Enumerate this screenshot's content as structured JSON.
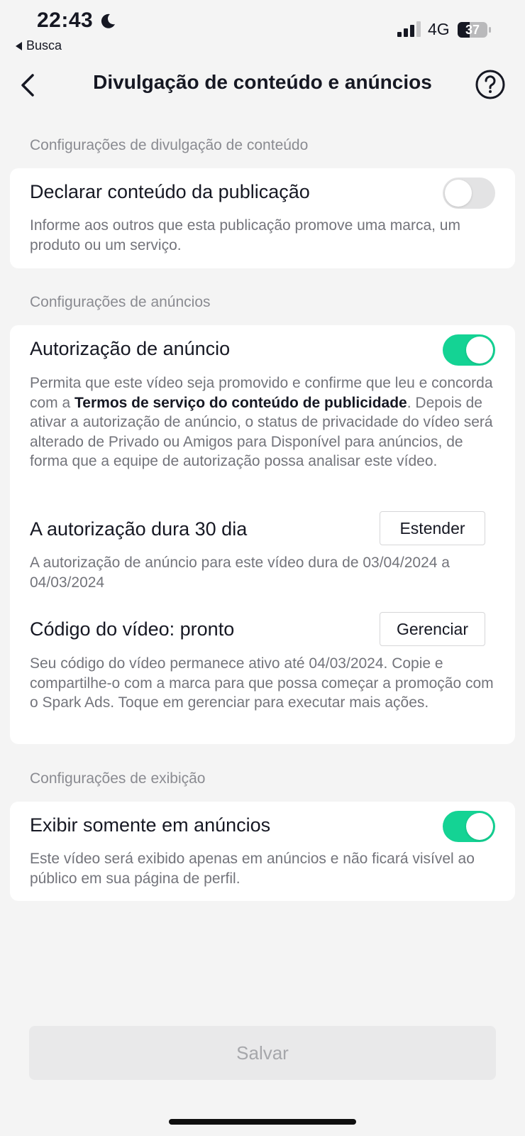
{
  "status_bar": {
    "time": "22:43",
    "back_app": "Busca",
    "network": "4G",
    "battery": "37"
  },
  "header": {
    "title": "Divulgação de conteúdo e anúncios"
  },
  "sections": {
    "content_disclosure": {
      "label": "Configurações de divulgação de conteúdo",
      "declare_title": "Declarar conteúdo da publicação",
      "declare_desc": "Informe aos outros que esta publicação promove uma marca, um produto ou um serviço.",
      "declare_enabled": false
    },
    "ads": {
      "label": "Configurações de anúncios",
      "auth_title": "Autorização de anúncio",
      "auth_desc_pre": "Permita que este vídeo seja promovido e confirme que leu e concorda com a ",
      "auth_desc_link": "Termos de serviço do conteúdo de publicidade",
      "auth_desc_post": ". Depois de ativar a autorização de anúncio, o status de privacidade do vídeo será alterado de Privado ou Amigos para Disponível para anúncios, de forma que a equipe de autorização possa analisar este vídeo.",
      "auth_enabled": true,
      "duration_title": "A autorização dura 30 dia",
      "extend_label": "Estender",
      "duration_desc": "A autorização de anúncio para este vídeo dura de 03/04/2024 a 04/03/2024",
      "code_title": "Código do vídeo: pronto",
      "manage_label": "Gerenciar",
      "code_desc": "Seu código do vídeo permanece ativo até 04/03/2024. Copie e compartilhe-o com a marca para que possa começar a promoção com o Spark Ads. Toque em gerenciar para executar mais ações."
    },
    "display": {
      "label": "Configurações de exibição",
      "ads_only_title": "Exibir somente em anúncios",
      "ads_only_desc": "Este vídeo será exibido apenas em anúncios e não ficará visível ao público em sua página de perfil.",
      "ads_only_enabled": true
    }
  },
  "footer": {
    "save_label": "Salvar"
  },
  "colors": {
    "accent": "#14d394",
    "background": "#f4f4f4"
  }
}
